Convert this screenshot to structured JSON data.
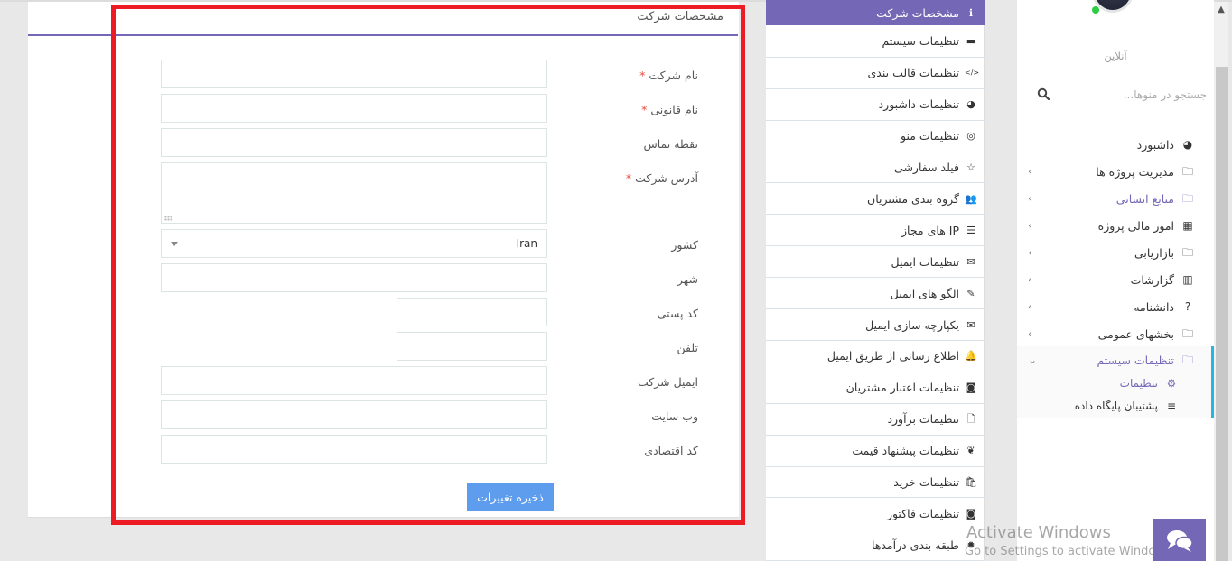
{
  "form": {
    "title": "مشخصات شرکت",
    "fields": [
      {
        "label": "نام شرکت",
        "required": true,
        "value": ""
      },
      {
        "label": "نام قانونی",
        "required": true,
        "value": ""
      },
      {
        "label": "نقطه تماس",
        "required": false,
        "value": ""
      },
      {
        "label": "آدرس شرکت",
        "required": true,
        "value": ""
      },
      {
        "label": "کشور",
        "required": false,
        "value": "Iran"
      },
      {
        "label": "شهر",
        "required": false,
        "value": ""
      },
      {
        "label": "کد پستی",
        "required": false,
        "value": ""
      },
      {
        "label": "تلفن",
        "required": false,
        "value": ""
      },
      {
        "label": "ایمیل شرکت",
        "required": false,
        "value": ""
      },
      {
        "label": "وب سایت",
        "required": false,
        "value": ""
      },
      {
        "label": "کد اقتصادی",
        "required": false,
        "value": ""
      }
    ],
    "required_mark": "*",
    "save_label": "ذخیره تغییرات"
  },
  "settings_menu": {
    "items": [
      {
        "label": "مشخصات شرکت",
        "icon": "info-circle-icon",
        "glyph": "ℹ",
        "active": true
      },
      {
        "label": "تنظیمات سیستم",
        "icon": "desktop-icon",
        "glyph": "▬"
      },
      {
        "label": "تنظیمات قالب بندی",
        "icon": "code-icon",
        "glyph": "</>"
      },
      {
        "label": "تنظیمات داشبورد",
        "icon": "dashboard-icon",
        "glyph": "◕"
      },
      {
        "label": "تنظیمات منو",
        "icon": "compass-icon",
        "glyph": "◎"
      },
      {
        "label": "فیلد سفارشی",
        "icon": "star-icon",
        "glyph": "☆"
      },
      {
        "label": "گروه بندی مشتریان",
        "icon": "users-icon",
        "glyph": "👥"
      },
      {
        "label": "IP های مجاز",
        "icon": "server-icon",
        "glyph": "☰"
      },
      {
        "label": "تنظیمات ایمیل",
        "icon": "envelope-icon",
        "glyph": "✉"
      },
      {
        "label": "الگو های ایمیل",
        "icon": "edit-icon",
        "glyph": "✎"
      },
      {
        "label": "یکپارچه سازی ایمیل",
        "icon": "envelope-outline-icon",
        "glyph": "✉"
      },
      {
        "label": "اطلاع رسانی از طریق ایمیل",
        "icon": "bell-icon",
        "glyph": "🔔"
      },
      {
        "label": "تنظیمات اعتبار مشتریان",
        "icon": "money-icon",
        "glyph": "◙"
      },
      {
        "label": "تنظیمات برآورد",
        "icon": "file-icon",
        "glyph": "🗋"
      },
      {
        "label": "تنظیمات پیشنهاد قیمت",
        "icon": "leaf-icon",
        "glyph": "❦"
      },
      {
        "label": "تنظیمات خرید",
        "icon": "shopping-bag-icon",
        "glyph": "🛍"
      },
      {
        "label": "تنظیمات فاکتور",
        "icon": "money-icon",
        "glyph": "◙"
      },
      {
        "label": "طبقه بندی درآمدها",
        "icon": "certificate-icon",
        "glyph": "✹"
      }
    ]
  },
  "sidebar": {
    "status": "آنلاین",
    "search_placeholder": "جستجو در منوها...",
    "items": [
      {
        "label": "داشبورد",
        "icon": "dashboard-icon",
        "glyph": "◕",
        "chevron": false
      },
      {
        "label": "مدیریت پروژه ها",
        "icon": "folder-icon",
        "glyph": "🗀",
        "chevron": true
      },
      {
        "label": "منابع انسانی",
        "icon": "folder-icon",
        "glyph": "🗀",
        "chevron": true,
        "highlight": true
      },
      {
        "label": "امور مالی پروژه",
        "icon": "calculator-icon",
        "glyph": "▦",
        "chevron": true
      },
      {
        "label": "بازاریابی",
        "icon": "folder-icon",
        "glyph": "🗀",
        "chevron": true
      },
      {
        "label": "گزارشات",
        "icon": "bar-chart-icon",
        "glyph": "▥",
        "chevron": true
      },
      {
        "label": "دانشنامه",
        "icon": "question-icon",
        "glyph": "?",
        "chevron": true
      },
      {
        "label": "بخشهای عمومی",
        "icon": "folder-icon",
        "glyph": "🗀",
        "chevron": true
      },
      {
        "label": "تنظیمات سیستم",
        "icon": "folder-icon",
        "glyph": "🗀",
        "chevron": "open",
        "highlight": true
      }
    ],
    "sub_items": [
      {
        "label": "تنظیمات",
        "icon": "cogs-icon",
        "glyph": "⚙",
        "highlight": true
      },
      {
        "label": "پشتیبان پایگاه داده",
        "icon": "database-icon",
        "glyph": "≡"
      }
    ],
    "chevron_closed": "‹",
    "chevron_open": "⌄"
  },
  "watermark": {
    "line1": "Activate Windows",
    "line2": "Go to Settings to activate Windows."
  },
  "colors": {
    "accent": "#7467b5",
    "save_button": "#5e9ded",
    "required": "#e74c3c",
    "highlight_frame": "#ed1c24",
    "online": "#2ecc40",
    "active_indicator": "#26b6e0"
  }
}
